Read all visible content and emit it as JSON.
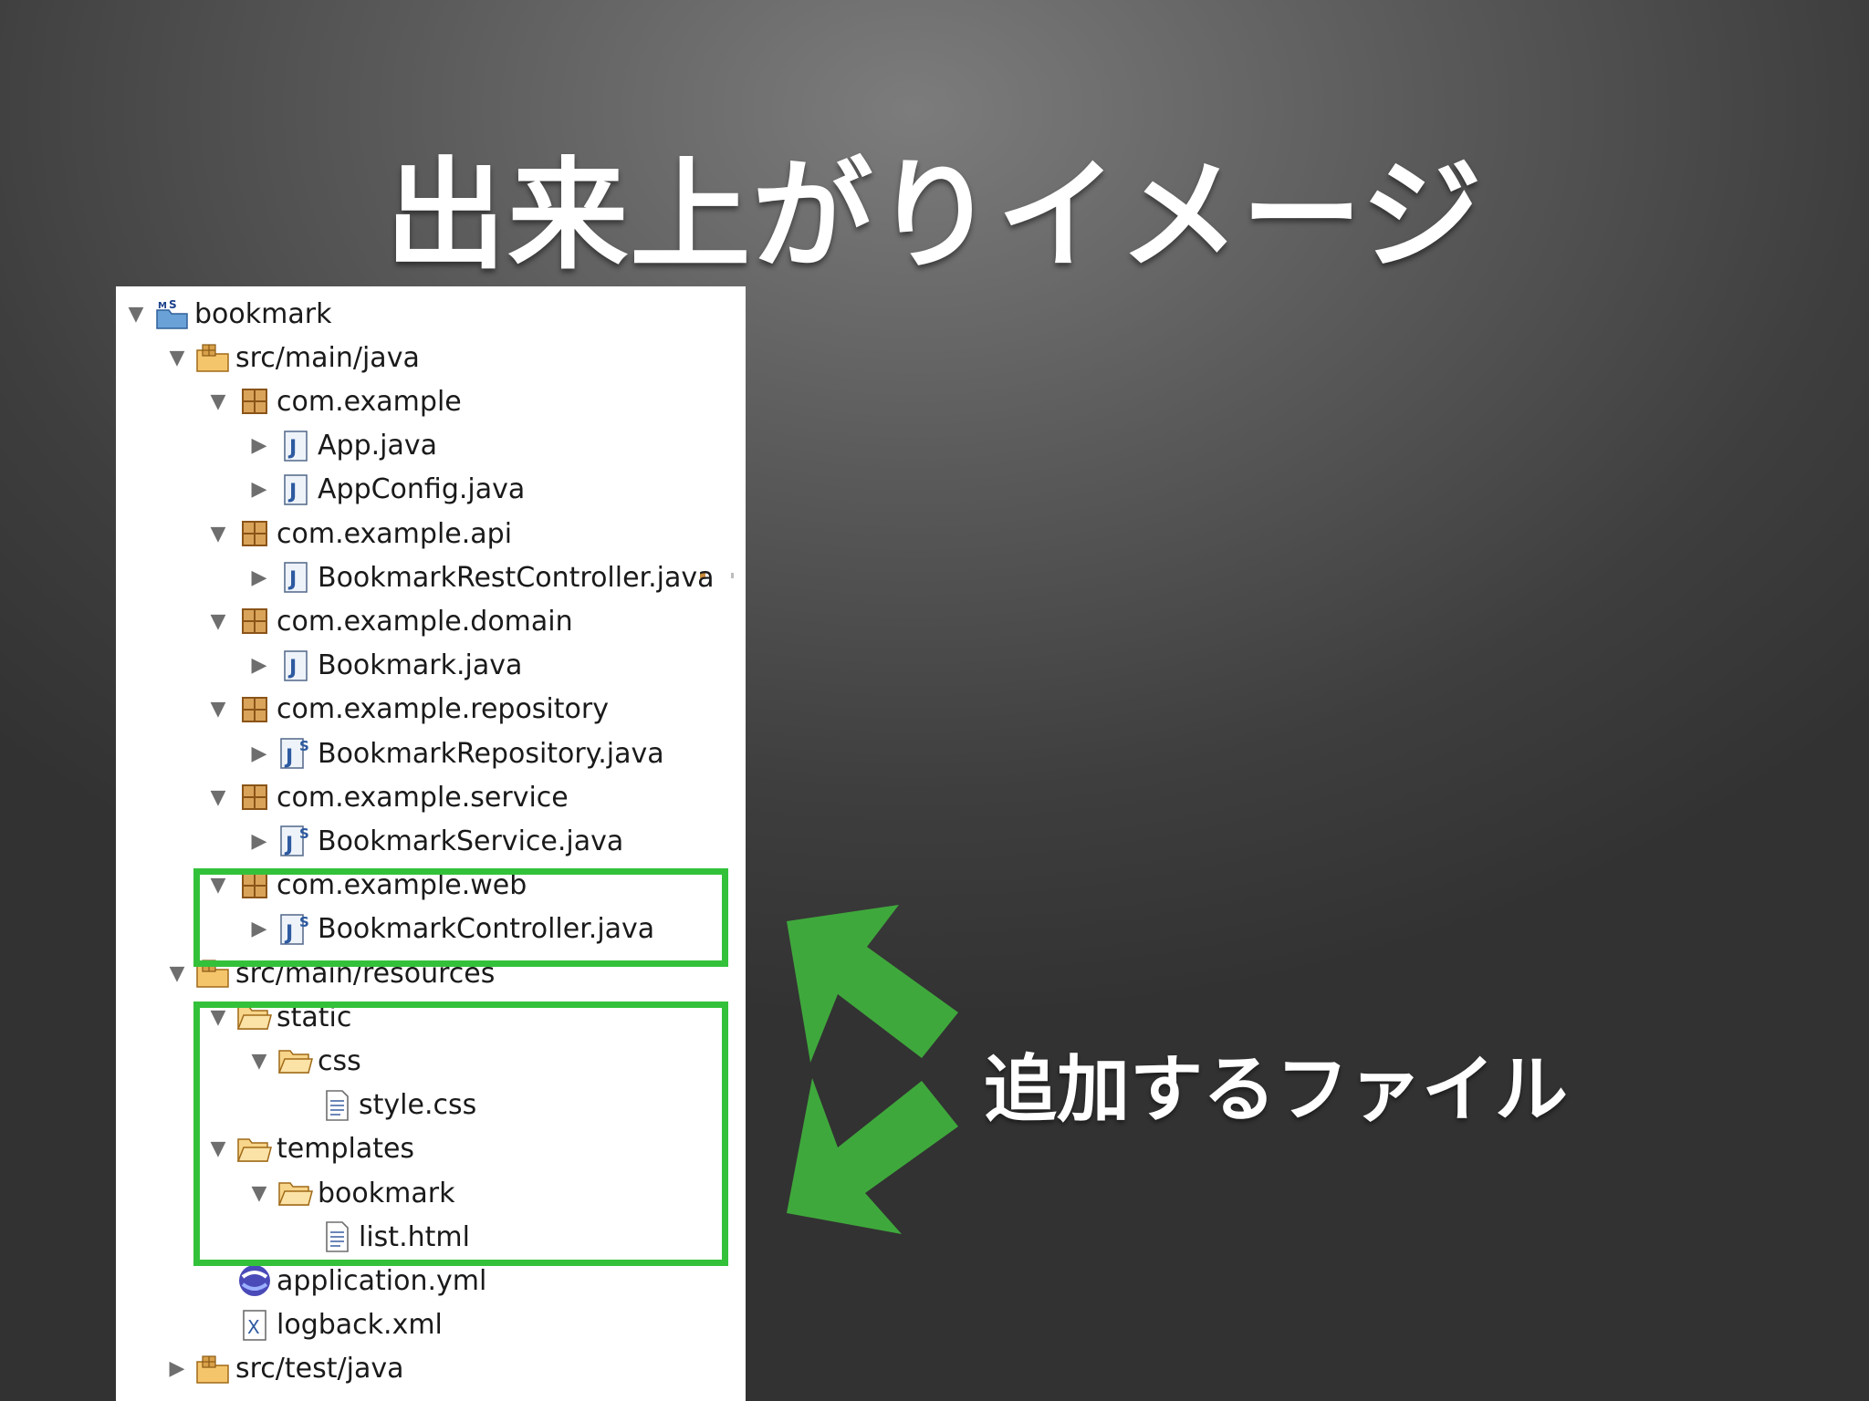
{
  "slide": {
    "title": "出来上がりイメージ",
    "callout": "追加するファイル"
  },
  "tree": [
    {
      "label": "bookmark",
      "icon": "maven-project-icon",
      "twisty": "expanded",
      "level": 0
    },
    {
      "label": "src/main/java",
      "icon": "source-folder-icon",
      "twisty": "expanded",
      "level": 1
    },
    {
      "label": "com.example",
      "icon": "package-icon",
      "twisty": "expanded",
      "level": 2
    },
    {
      "label": "App.java",
      "icon": "java-file-icon",
      "twisty": "collapsed",
      "level": 3
    },
    {
      "label": "AppConfig.java",
      "icon": "java-file-icon",
      "twisty": "collapsed",
      "level": 3
    },
    {
      "label": "com.example.api",
      "icon": "package-icon",
      "twisty": "expanded",
      "level": 2
    },
    {
      "label": "BookmarkRestController.java",
      "icon": "java-file-icon",
      "twisty": "collapsed",
      "level": 3
    },
    {
      "label": "com.example.domain",
      "icon": "package-icon",
      "twisty": "expanded",
      "level": 2
    },
    {
      "label": "Bookmark.java",
      "icon": "java-file-icon",
      "twisty": "collapsed",
      "level": 3
    },
    {
      "label": "com.example.repository",
      "icon": "package-icon",
      "twisty": "expanded",
      "level": 2
    },
    {
      "label": "BookmarkRepository.java",
      "icon": "spring-java-file-icon",
      "twisty": "collapsed",
      "level": 3
    },
    {
      "label": "com.example.service",
      "icon": "package-icon",
      "twisty": "expanded",
      "level": 2
    },
    {
      "label": "BookmarkService.java",
      "icon": "spring-java-file-icon",
      "twisty": "collapsed",
      "level": 3
    },
    {
      "label": "com.example.web",
      "icon": "package-icon",
      "twisty": "expanded",
      "level": 2
    },
    {
      "label": "BookmarkController.java",
      "icon": "spring-java-file-icon",
      "twisty": "collapsed",
      "level": 3
    },
    {
      "label": "src/main/resources",
      "icon": "source-folder-icon",
      "twisty": "expanded",
      "level": 1
    },
    {
      "label": "static",
      "icon": "folder-icon",
      "twisty": "expanded",
      "level": 2
    },
    {
      "label": "css",
      "icon": "folder-icon",
      "twisty": "expanded",
      "level": 3
    },
    {
      "label": "style.css",
      "icon": "text-file-icon",
      "twisty": "none",
      "level": 4
    },
    {
      "label": "templates",
      "icon": "folder-icon",
      "twisty": "expanded",
      "level": 2
    },
    {
      "label": "bookmark",
      "icon": "folder-icon",
      "twisty": "expanded",
      "level": 3
    },
    {
      "label": "list.html",
      "icon": "text-file-icon",
      "twisty": "none",
      "level": 4
    },
    {
      "label": "application.yml",
      "icon": "yaml-file-icon",
      "twisty": "none",
      "level": 2
    },
    {
      "label": "logback.xml",
      "icon": "xml-file-icon",
      "twisty": "none",
      "level": 2
    },
    {
      "label": "src/test/java",
      "icon": "source-folder-icon",
      "twisty": "collapsed",
      "level": 1
    }
  ],
  "colors": {
    "highlight": "#33c13a",
    "arrow": "#3fa83c",
    "title": "#ffffff"
  }
}
